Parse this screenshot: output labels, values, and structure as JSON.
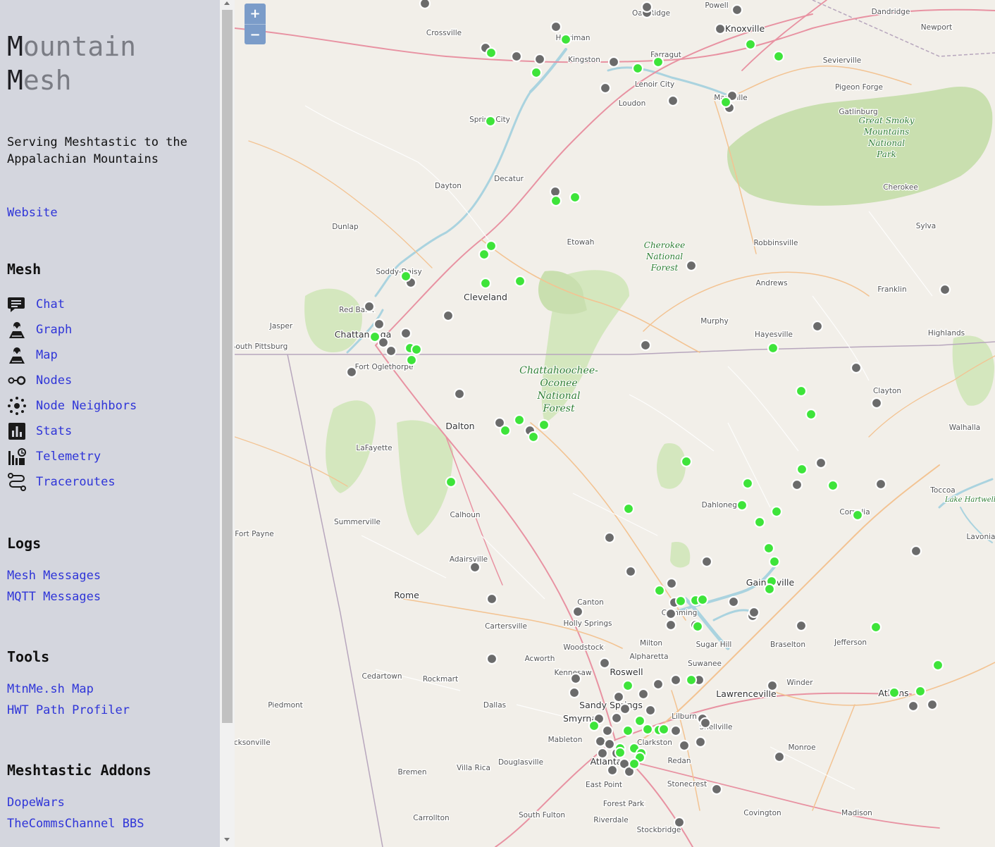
{
  "sidebar": {
    "title_lines": [
      {
        "initial": "M",
        "rest": "ountain"
      },
      {
        "initial": "M",
        "rest": "esh"
      }
    ],
    "tagline": "Serving Meshtastic to the Appalachian Mountains",
    "website_label": "Website",
    "mesh_heading": "Mesh",
    "mesh_items": [
      {
        "label": "Chat",
        "icon": "chat-icon"
      },
      {
        "label": "Graph",
        "icon": "graph-icon"
      },
      {
        "label": "Map",
        "icon": "map-icon"
      },
      {
        "label": "Nodes",
        "icon": "nodes-icon"
      },
      {
        "label": "Node Neighbors",
        "icon": "node-neighbors-icon"
      },
      {
        "label": "Stats",
        "icon": "stats-icon"
      },
      {
        "label": "Telemetry",
        "icon": "telemetry-icon"
      },
      {
        "label": "Traceroutes",
        "icon": "traceroutes-icon"
      }
    ],
    "logs_heading": "Logs",
    "logs_items": [
      "Mesh Messages",
      "MQTT Messages"
    ],
    "tools_heading": "Tools",
    "tools_items": [
      "MtnMe.sh Map",
      "HWT Path Profiler"
    ],
    "addons_heading": "Meshtastic Addons",
    "addons_items": [
      "DopeWars",
      "TheCommsChannel BBS"
    ]
  },
  "map": {
    "zoom_in": "+",
    "zoom_out": "−",
    "colors": {
      "online_node": "#3ee43a",
      "offline_node": "#6b6b6b",
      "water": "#aad3df",
      "park": "#a8d08d"
    },
    "city_labels": [
      "Knoxville",
      "Chattanooga",
      "Cleveland",
      "Dalton",
      "Rome",
      "Roswell",
      "Lawrenceville",
      "Athens",
      "Sandy Springs",
      "Smyrna",
      "Atlanta",
      "Gainesville"
    ],
    "town_labels": [
      "Oak Ridge",
      "Powell",
      "Dandridge",
      "Newport",
      "Crossville",
      "Harriman",
      "Kingston",
      "Farragut",
      "Sevierville",
      "Lenoir City",
      "Loudon",
      "Pigeon Forge",
      "Maryville",
      "Gatlinburg",
      "Spring City",
      "Decatur",
      "Dayton",
      "Dunlap",
      "Etowah",
      "Robbinsville",
      "Cherokee",
      "Sylva",
      "Soddy-Daisy",
      "Red Bank",
      "Jasper",
      "South Pittsburg",
      "Andrews",
      "Franklin",
      "Murphy",
      "Hayesville",
      "Highlands",
      "Fort Oglethorpe",
      "Clayton",
      "Walhalla",
      "LaFayette",
      "Calhoun",
      "Dahlonega",
      "Toccoa",
      "Summerville",
      "Fort Payne",
      "Cornelia",
      "Lavonia",
      "Adairsville",
      "Canton",
      "Cartersville",
      "Holly Springs",
      "Cumming",
      "Woodstock",
      "Milton",
      "Alpharetta",
      "Sugar Hill",
      "Braselton",
      "Jefferson",
      "Acworth",
      "Kennesaw",
      "Suwanee",
      "Cedartown",
      "Rockmart",
      "Winder",
      "Piedmont",
      "Dallas",
      "Mableton",
      "Lilburn",
      "Snellville",
      "Jacksonville",
      "Villa Rica",
      "Douglasville",
      "Bremen",
      "Clarkston",
      "Monroe",
      "Redan",
      "Stonecrest",
      "East Point",
      "Forest Park",
      "Carrollton",
      "South Fulton",
      "Riverdale",
      "Covington",
      "Madison",
      "Stockbridge"
    ],
    "park_labels": [
      "Great Smoky Mountains National Park",
      "Cherokee National Forest",
      "Chattahoochee-Oconee National Forest"
    ],
    "lake_labels": [
      "Lake Hartwell"
    ]
  }
}
